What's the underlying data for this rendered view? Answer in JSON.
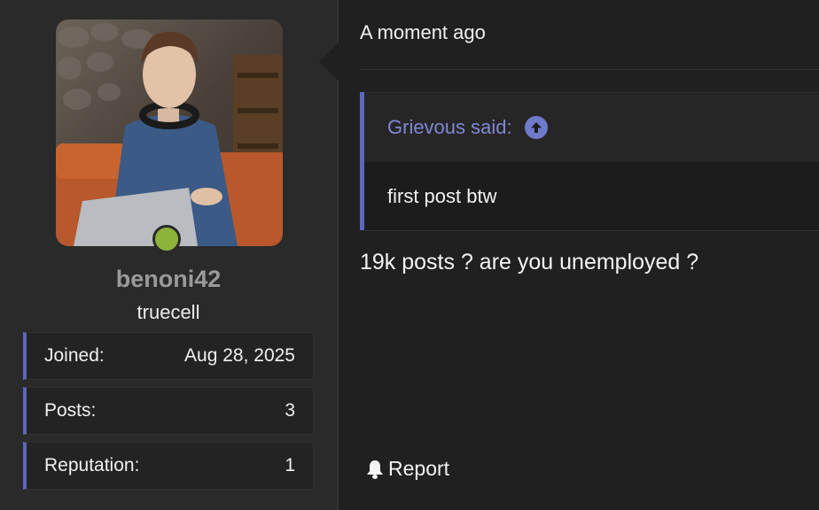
{
  "author": {
    "username": "benoni42",
    "user_title": "truecell",
    "avatar_alt": "avatar",
    "online_color": "#8db33a",
    "stats": [
      {
        "label": "Joined:",
        "value": "Aug 28, 2025"
      },
      {
        "label": "Posts:",
        "value": "3"
      },
      {
        "label": "Reputation:",
        "value": "1"
      }
    ]
  },
  "post": {
    "timestamp": "A moment ago",
    "quote": {
      "attribution": "Grievous said:",
      "text": "first post btw"
    },
    "message": "19k posts ? are you unemployed ?",
    "actions": {
      "report_label": "Report"
    }
  },
  "colors": {
    "accent": "#5c67bd",
    "quote_attribution": "#7f88d4",
    "background": "#202020",
    "sidebar": "#2a2a2a"
  }
}
